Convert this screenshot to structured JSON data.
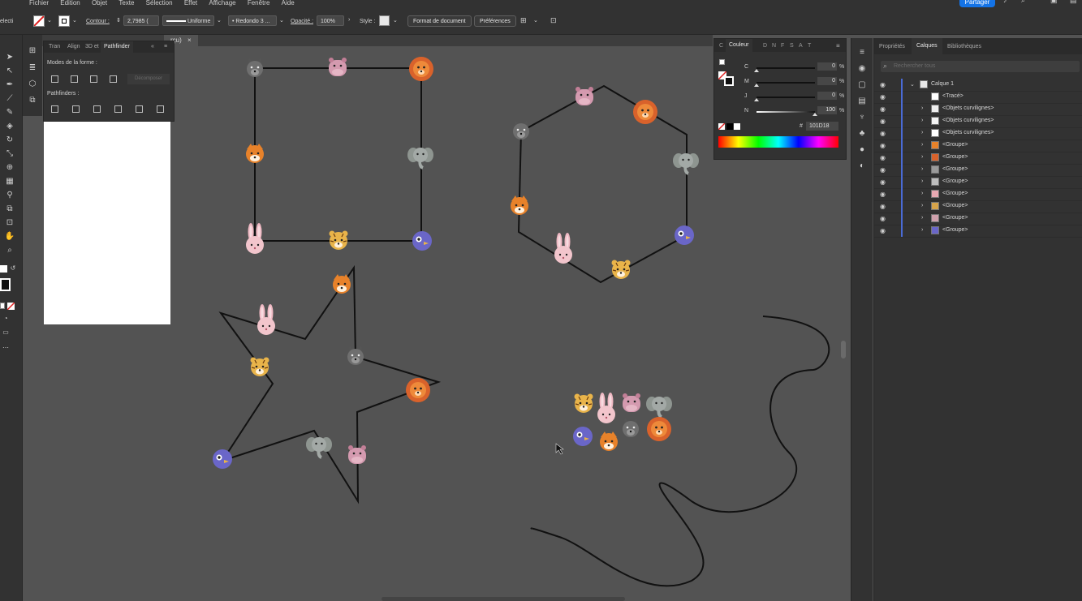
{
  "menu": {
    "items": [
      "Fichier",
      "Edition",
      "Objet",
      "Texte",
      "Sélection",
      "Effet",
      "Affichage",
      "Fenêtre",
      "Aide"
    ],
    "share_label": "Partager"
  },
  "controlbar": {
    "selection_label": "electi",
    "contour_label": "Contour :",
    "stroke_width": "2,7985 (",
    "profile_label": "Uniforme",
    "brush_label": "Redondo 3 ...",
    "opacity_label": "Opacité :",
    "opacity_value": "100%",
    "style_label": "Style :",
    "doc_format_button": "Format de document",
    "preferences_button": "Préférences"
  },
  "document_tab": {
    "label": "rçu)",
    "close_glyph": "×"
  },
  "pathfinder": {
    "tabs": [
      "Tran",
      "Align",
      "3D et",
      "Pathfinder"
    ],
    "shape_modes_label": "Modes de la forme :",
    "expand_label": "Décomposer",
    "pathfinders_label": "Pathfinders :"
  },
  "color": {
    "tabs": [
      "C",
      "Couleur",
      "D",
      "N",
      "F",
      "S",
      "A",
      "T"
    ],
    "channels": [
      {
        "label": "C",
        "value": "0",
        "fill": 0
      },
      {
        "label": "M",
        "value": "0",
        "fill": 0
      },
      {
        "label": "J",
        "value": "0",
        "fill": 0
      },
      {
        "label": "N",
        "value": "100",
        "fill": 1
      }
    ],
    "percent": "%",
    "hash": "#",
    "hex": "101D18"
  },
  "layers": {
    "tabs": [
      "Propriétés",
      "Calques",
      "Bibliothèques"
    ],
    "search_placeholder": "Rechercher tous",
    "rows": [
      {
        "name": "Calque 1",
        "level": 0,
        "expanded": true,
        "thumb": "#e8e8e8"
      },
      {
        "name": "<Tracé>",
        "level": 1,
        "arrow": false,
        "thumb": "#ffffff"
      },
      {
        "name": "<Objets curvilignes>",
        "level": 1,
        "arrow": true,
        "thumb": "#eeeeee"
      },
      {
        "name": "<Objets curvilignes>",
        "level": 1,
        "arrow": true,
        "thumb": "#f4f4f4"
      },
      {
        "name": "<Objets curvilignes>",
        "level": 1,
        "arrow": true,
        "thumb": "#ffffff"
      },
      {
        "name": "<Groupe>",
        "level": 1,
        "arrow": true,
        "thumb": "#e8822a"
      },
      {
        "name": "<Groupe>",
        "level": 1,
        "arrow": true,
        "thumb": "#d9622b"
      },
      {
        "name": "<Groupe>",
        "level": 1,
        "arrow": true,
        "thumb": "#9a9a9a"
      },
      {
        "name": "<Groupe>",
        "level": 1,
        "arrow": true,
        "thumb": "#bdbdbd"
      },
      {
        "name": "<Groupe>",
        "level": 1,
        "arrow": true,
        "thumb": "#e7a9b2"
      },
      {
        "name": "<Groupe>",
        "level": 1,
        "arrow": true,
        "thumb": "#d7a44a"
      },
      {
        "name": "<Groupe>",
        "level": 1,
        "arrow": true,
        "thumb": "#cfa0ac"
      },
      {
        "name": "<Groupe>",
        "level": 1,
        "arrow": true,
        "thumb": "#6a66c8"
      }
    ]
  },
  "colors": {
    "ui_bg": "#535353",
    "panel": "#323232",
    "accent": "#1473e6",
    "layer_bar": "#4a6bd6",
    "fox": "#e8822a",
    "lion": "#d9622b",
    "tiger": "#e9b44a",
    "bunny": "#efb9c3",
    "hippo": "#d49aaf",
    "elephant": "#a3a9a6",
    "wolf": "#6f6f6f",
    "bird": "#6a66c8"
  },
  "icons": [
    "selection-icon",
    "direct-selection-icon",
    "pen-icon",
    "curvature-icon",
    "brush-icon",
    "eraser-icon",
    "rotate-icon",
    "scale-icon",
    "shape-builder-icon",
    "gradient-icon",
    "eyedropper-icon",
    "blend-icon",
    "artboard-icon",
    "hand-icon",
    "zoom-icon",
    "fill-stroke-icon",
    "bell-icon",
    "search-icon",
    "window-icon"
  ]
}
